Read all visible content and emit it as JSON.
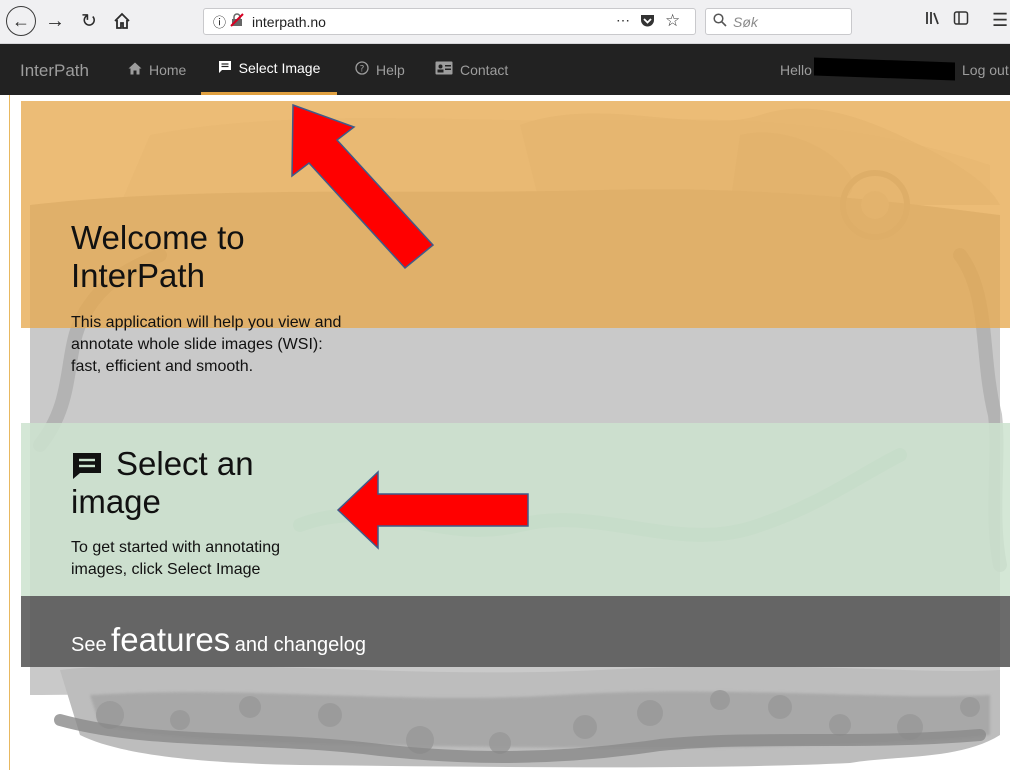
{
  "browser": {
    "url": "interpath.no",
    "search_placeholder": "Søk",
    "icons": [
      "back-icon",
      "forward-icon",
      "reload-icon",
      "home-icon",
      "info-icon",
      "insecure-lock-icon",
      "more-icon",
      "pocket-icon",
      "bookmark-star-icon",
      "search-icon",
      "library-icon",
      "sidebar-icon",
      "menu-icon"
    ]
  },
  "appnav": {
    "brand": "InterPath",
    "items": [
      {
        "label": "Home",
        "icon": "home-icon"
      },
      {
        "label": "Select Image",
        "icon": "message-icon",
        "active": true
      },
      {
        "label": "Help",
        "icon": "help-circle-icon"
      },
      {
        "label": "Contact",
        "icon": "contact-card-icon"
      }
    ],
    "greeting": "Hello",
    "logout": "Log out",
    "accent": "#e0a040"
  },
  "welcome": {
    "title": "Welcome to InterPath",
    "text": "This application will help you view and annotate whole slide images (WSI): fast, efficient and smooth."
  },
  "select": {
    "title": "Select an image",
    "icon": "message-icon",
    "text": "To get started with annotating images, click Select Image"
  },
  "features": {
    "prefix": "See",
    "link": "features",
    "suffix": "and changelog"
  },
  "colors": {
    "welcome_band": "#e7a950",
    "select_band": "#cce3cf",
    "features_band": "#565656",
    "annotation_arrow": "#ff0000"
  }
}
